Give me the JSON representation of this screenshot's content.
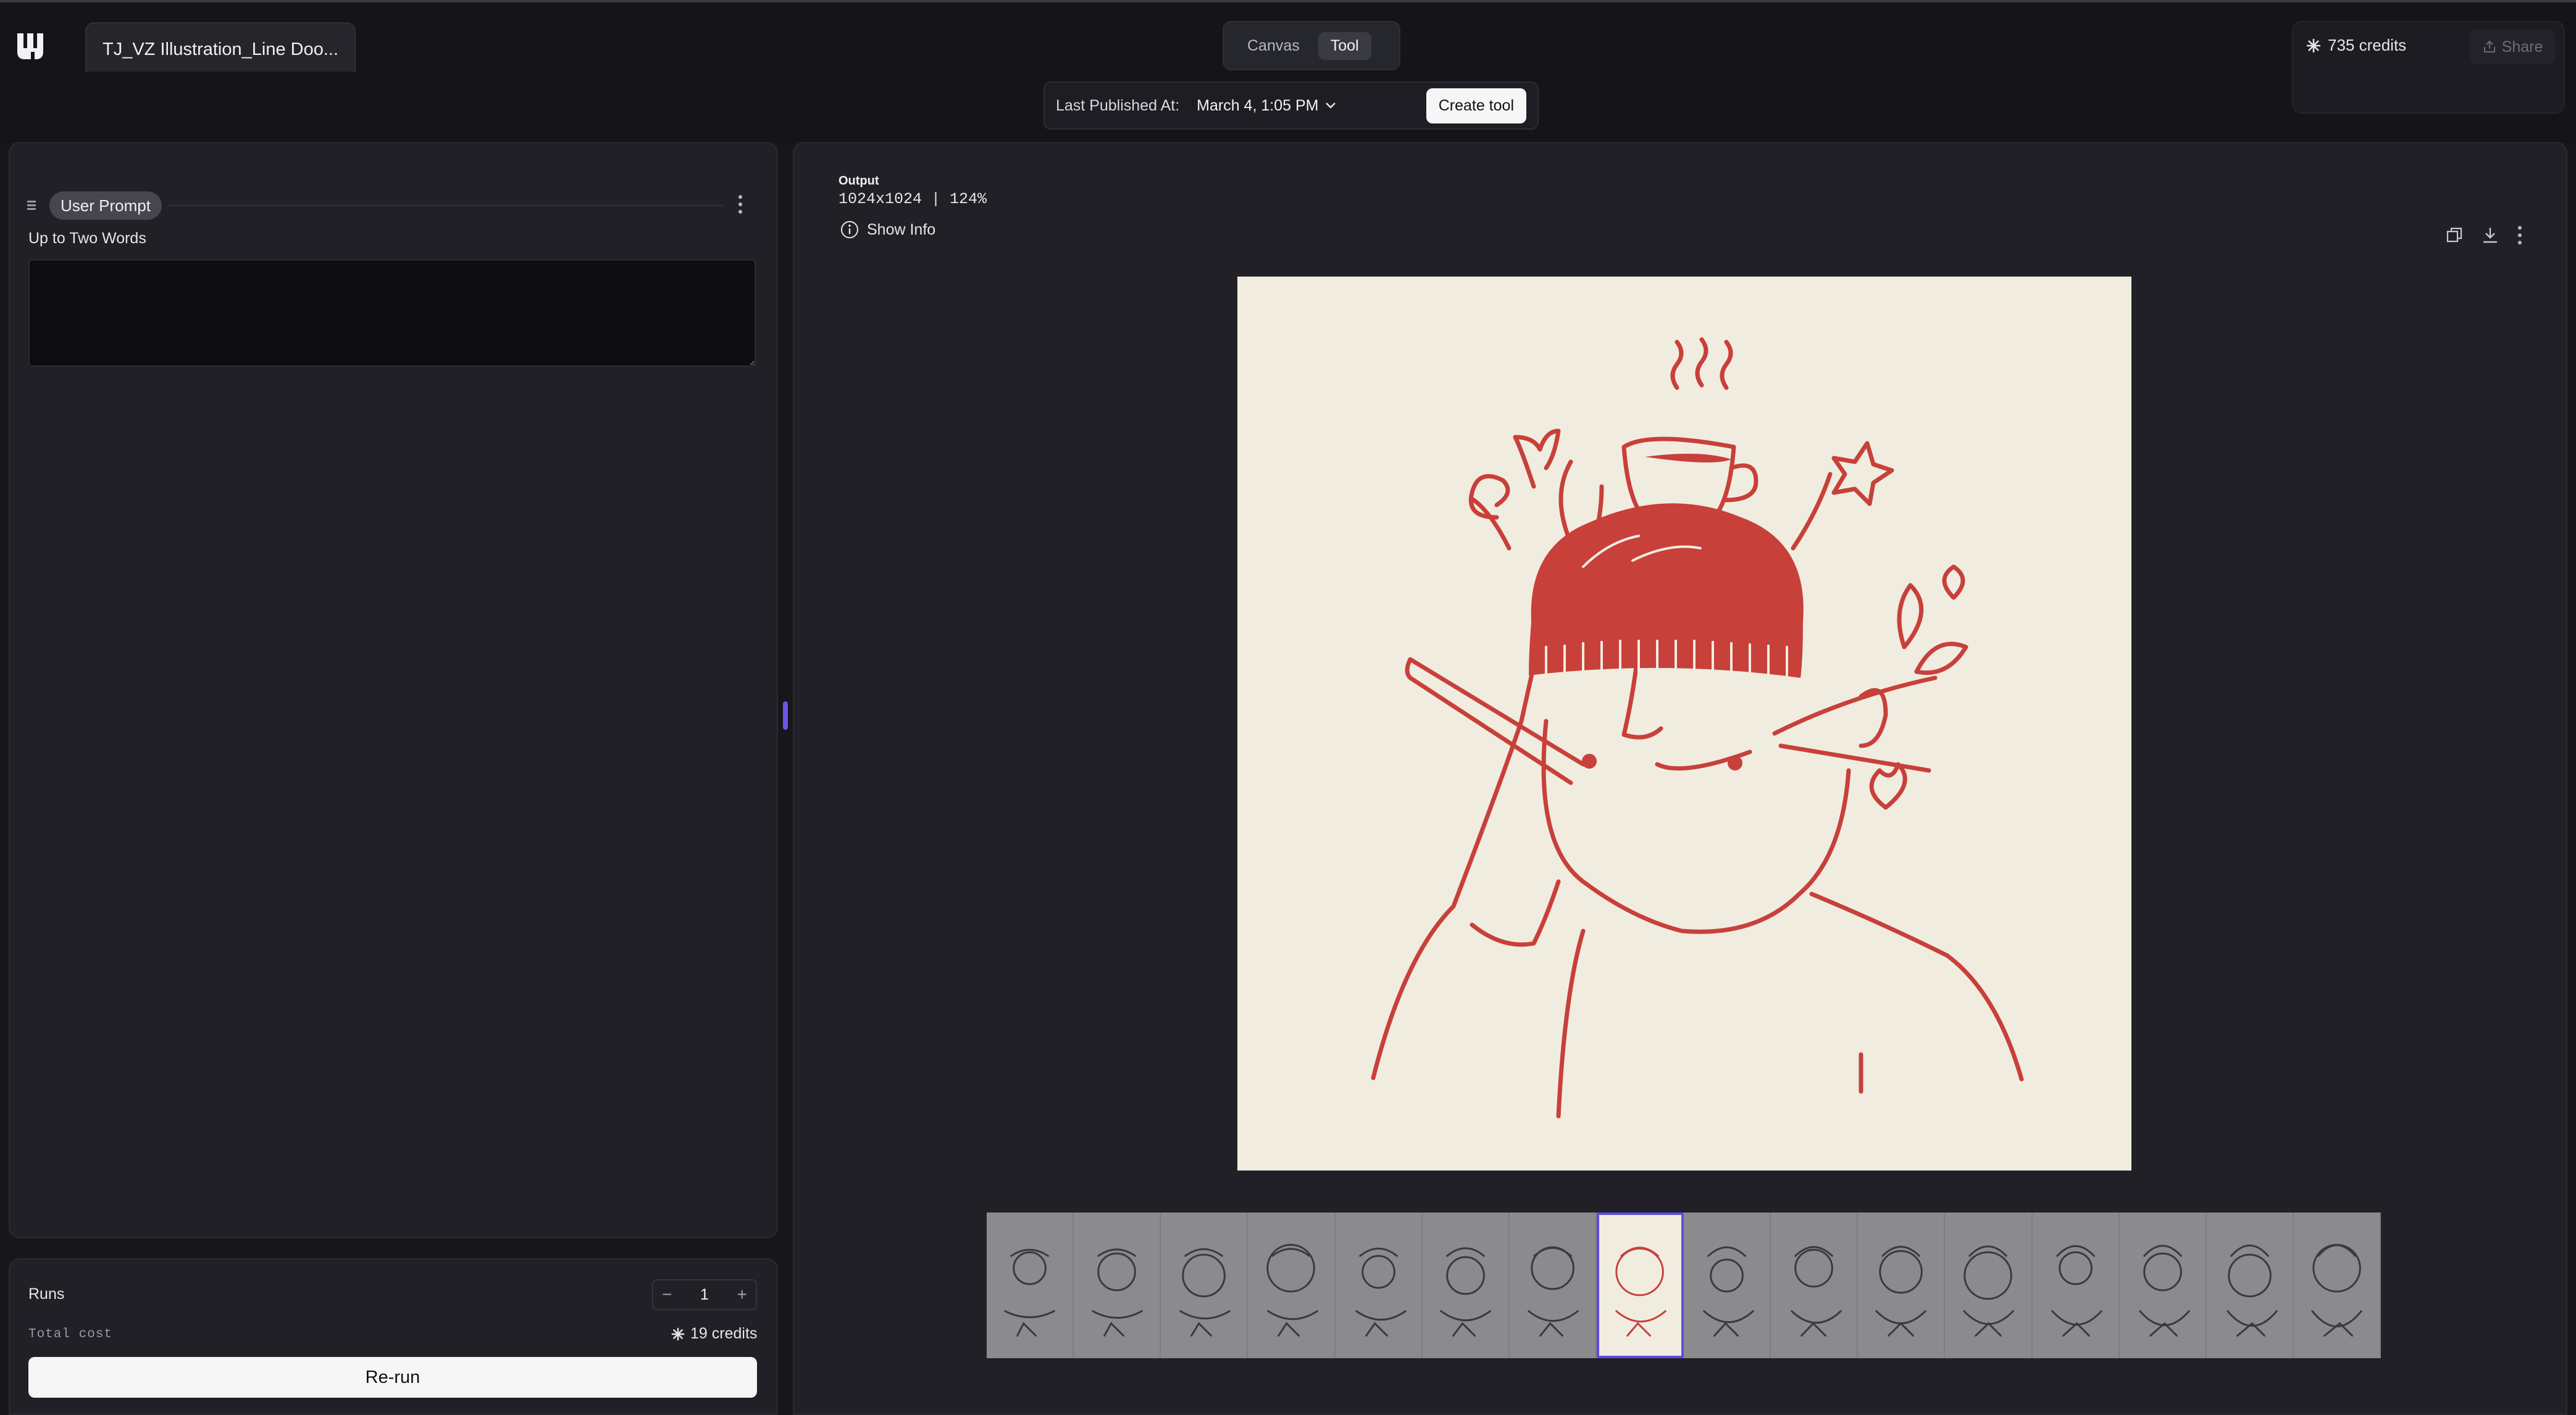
{
  "app": {
    "document_title": "TJ_VZ Illustration_Line Doo..."
  },
  "header": {
    "view_tabs": [
      {
        "label": "Canvas",
        "active": false
      },
      {
        "label": "Tool",
        "active": true
      }
    ],
    "published_label": "Last Published At:",
    "published_date": "March 4, 1:05 PM",
    "create_tool_label": "Create tool",
    "credits_label": "735 credits",
    "share_label": "Share"
  },
  "left_panel": {
    "node_chip": "User Prompt",
    "field_label": "Up to Two Words",
    "prompt_value": "",
    "runs_label": "Runs",
    "runs_value": "1",
    "stepper_minus": "−",
    "stepper_plus": "+",
    "total_cost_label": "Total cost",
    "total_cost_value": "19 credits",
    "rerun_label": "Re-run"
  },
  "output": {
    "title": "Output",
    "dims": "1024x1024 | 124%",
    "show_info_label": "Show Info",
    "thumbnails_count": 16,
    "selected_thumbnail": 7
  },
  "colors": {
    "accent": "#5b4de0",
    "illustration_red": "#c8403a",
    "paper": "#f1ece0"
  },
  "icons": [
    "app-logo-icon",
    "chevron-down-icon",
    "asterisk-credit-icon",
    "share-icon",
    "kebab-menu-icon",
    "drag-handle-icon",
    "info-icon",
    "copy-icon",
    "download-icon"
  ]
}
